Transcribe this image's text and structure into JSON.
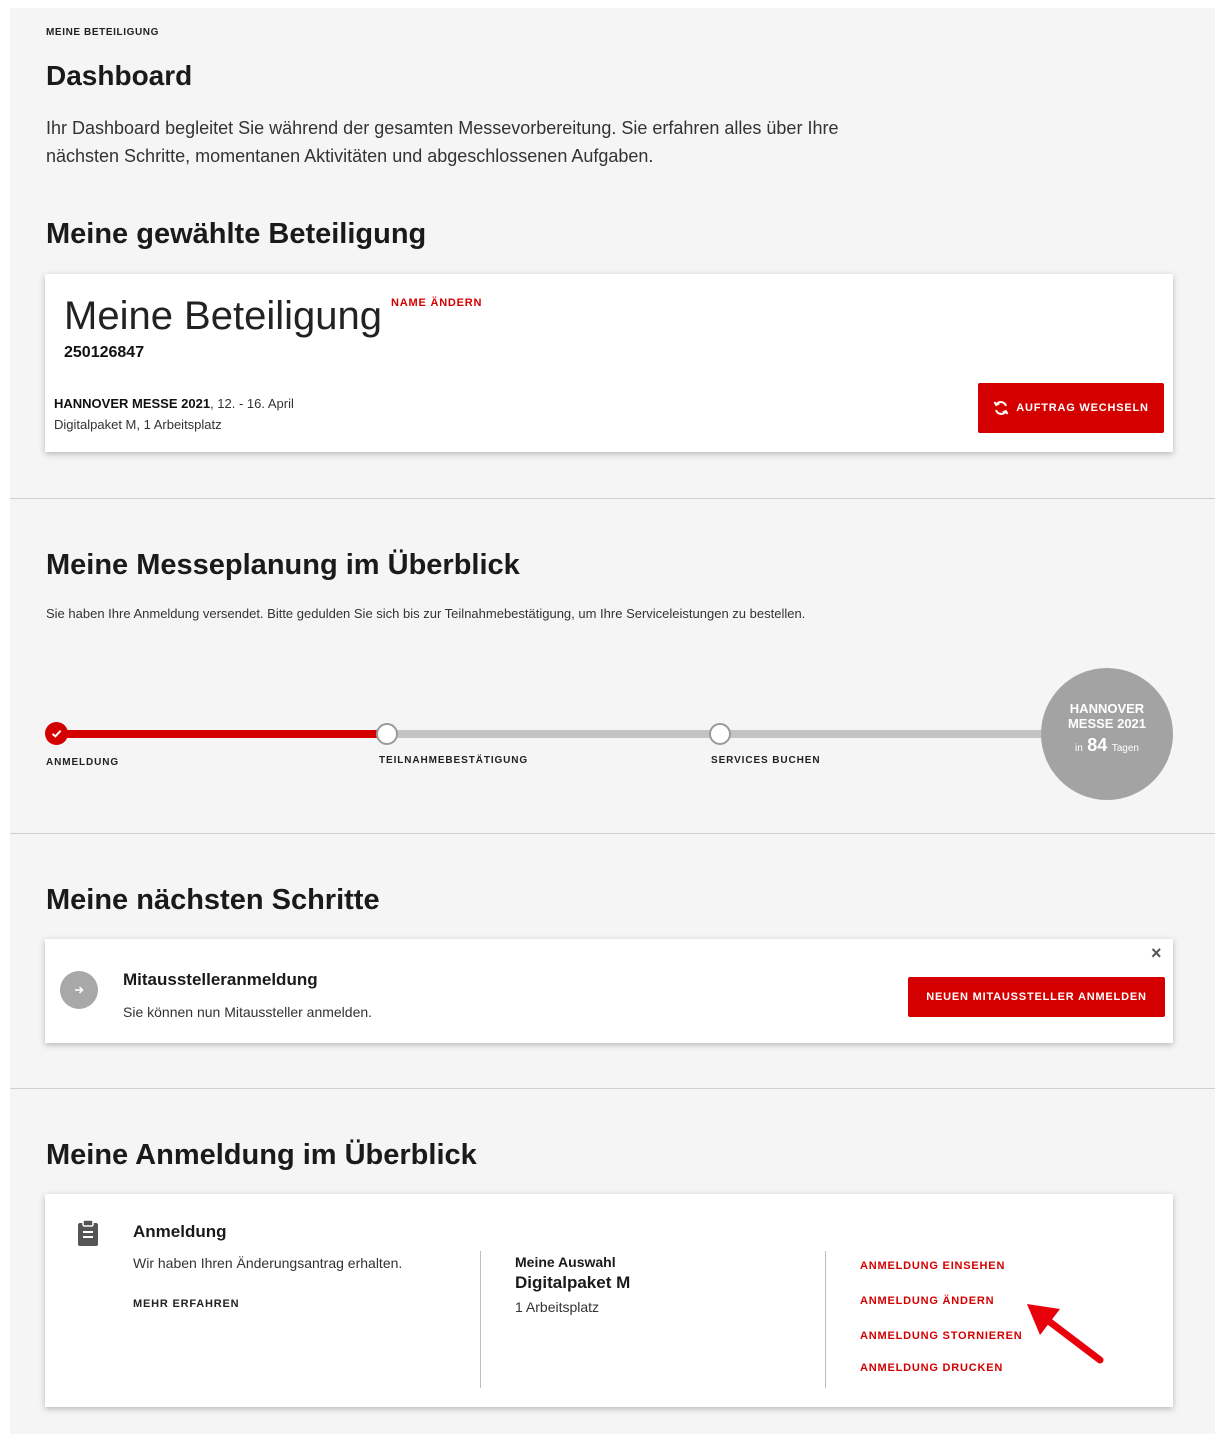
{
  "header": {
    "eyebrow": "MEINE BETEILIGUNG",
    "title": "Dashboard",
    "intro": "Ihr Dashboard begleitet Sie während der gesamten Messevorbereitung. Sie erfahren alles über Ihre nächsten Schritte, momentanen Aktivitäten und abgeschlossenen Aufgaben."
  },
  "participation": {
    "heading": "Meine gewählte Beteiligung",
    "name": "Meine Beteiligung",
    "rename_label": "NAME ÄNDERN",
    "number": "250126847",
    "fair_name": "HANNOVER MESSE 2021",
    "fair_dates": ", 12. - 16. April",
    "package": "Digitalpaket M, 1 Arbeitsplatz",
    "switch_label": "AUFTRAG WECHSELN"
  },
  "planning": {
    "heading": "Meine Messeplanung im Überblick",
    "text": "Sie haben Ihre Anmeldung versendet. Bitte gedulden Sie sich bis zur Teilnahmebestätigung, um Ihre Serviceleistungen zu bestellen.",
    "steps": [
      {
        "label": "ANMELDUNG",
        "done": true
      },
      {
        "label": "TEILNAHMEBESTÄTIGUNG",
        "done": false
      },
      {
        "label": "SERVICES BUCHEN",
        "done": false
      }
    ],
    "progress": 0.33,
    "countdown": {
      "line1": "HANNOVER",
      "line2": "MESSE 2021",
      "prefix": "in",
      "days": "84",
      "suffix": "Tagen"
    }
  },
  "next_steps": {
    "heading": "Meine nächsten Schritte",
    "item_title": "Mitausstelleranmeldung",
    "item_text": "Sie können nun Mitaussteller anmelden.",
    "button_label": "NEUEN MITAUSSTELLER ANMELDEN",
    "close_glyph": "×"
  },
  "registration": {
    "heading": "Meine Anmeldung im Überblick",
    "title": "Anmeldung",
    "status": "Wir haben Ihren Änderungsantrag erhalten.",
    "more_label": "MEHR ERFAHREN",
    "selection_label": "Meine Auswahl",
    "selection_value": "Digitalpaket M",
    "selection_detail": "1 Arbeitsplatz",
    "actions": [
      "ANMELDUNG EINSEHEN",
      "ANMELDUNG ÄNDERN",
      "ANMELDUNG STORNIEREN",
      "ANMELDUNG DRUCKEN"
    ]
  },
  "colors": {
    "accent": "#d40000",
    "background": "#f5f5f5",
    "inactive": "#c4c4c4"
  },
  "icons": [
    "check-icon",
    "refresh-icon",
    "arrow-right-icon",
    "close-icon",
    "clipboard-icon",
    "red-arrow-pointer"
  ]
}
